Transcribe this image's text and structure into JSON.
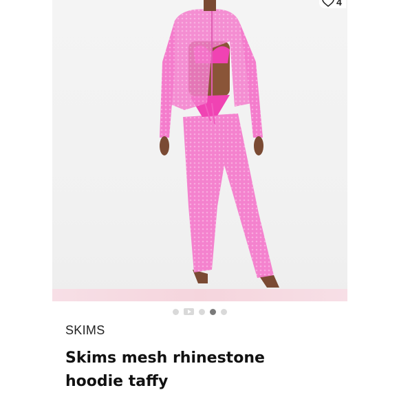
{
  "listing": {
    "like_icon": "heart-icon",
    "like_count": "4",
    "image_alt": "Pink mesh hoodie and pants outfit",
    "carousel": {
      "total": 5,
      "active_index": 3,
      "items": [
        "image",
        "video",
        "image",
        "image",
        "image"
      ]
    },
    "brand": "SKIMS",
    "title": "Skims mesh rhinestone hoodie taffy"
  },
  "colors": {
    "outfit": "#f26ec3",
    "background": "#f2f2f2",
    "accent_dot": "#7a7a7a"
  }
}
